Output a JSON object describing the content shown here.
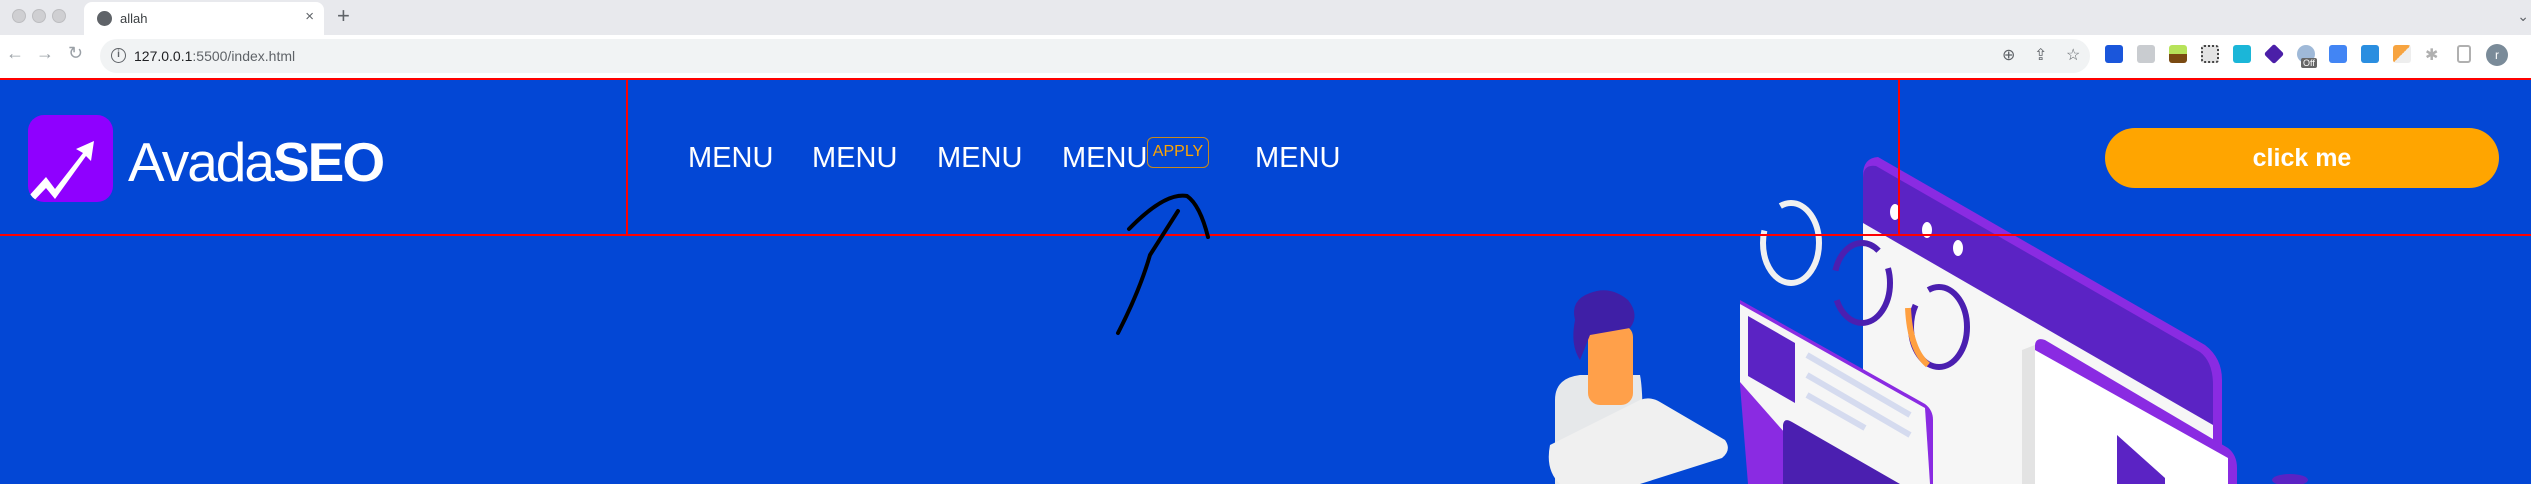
{
  "browser": {
    "tab_title": "allah",
    "tab_close": "×",
    "new_tab": "+",
    "url_host": "127.0.0.1",
    "url_rest": ":5500/index.html",
    "extension_badge": "Off",
    "profile_initial": "r"
  },
  "site": {
    "logo_light": "Avada",
    "logo_bold": "SEO",
    "menu": [
      "MENU",
      "MENU",
      "MENU",
      "MENU",
      "MENU"
    ],
    "apply_badge": "APPLY",
    "cta_label": "click me"
  },
  "colors": {
    "background": "#0347d5",
    "logo_bg": "#8f00ff",
    "accent": "#ffa500",
    "debug_border": "#ff0000"
  }
}
